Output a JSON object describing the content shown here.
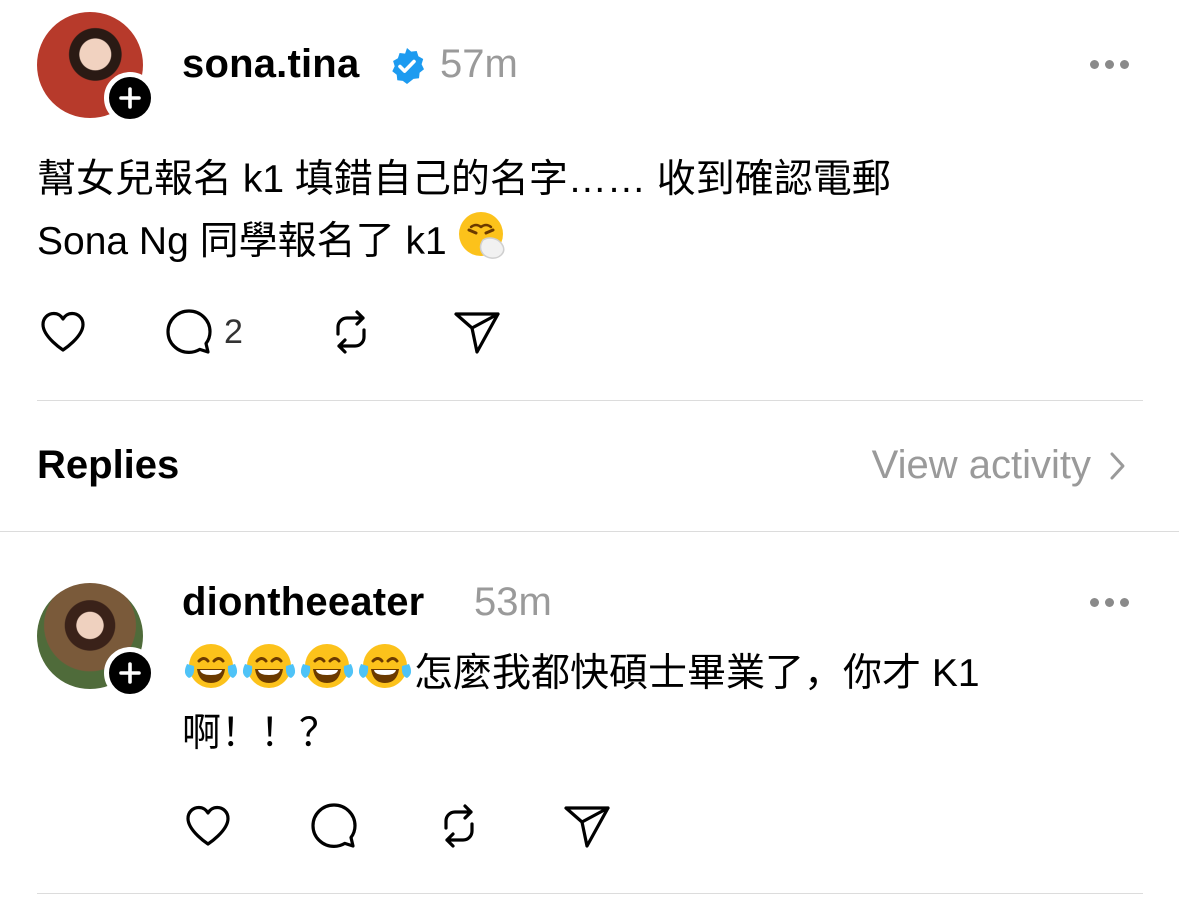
{
  "post": {
    "username": "sona.tina",
    "verified": true,
    "time": "57m",
    "text_line1": "幫女兒報名 k1 填錯自己的名字…… 收到確認電郵",
    "text_line2": "Sona Ng 同學報名了 k1",
    "text_emoji": "sneezing-face",
    "reply_count": "2",
    "actions": [
      "like",
      "comment",
      "repost",
      "share"
    ]
  },
  "replies_header": {
    "label": "Replies",
    "view_activity": "View activity"
  },
  "reply": {
    "username": "diontheeater",
    "time": "53m",
    "emojis": [
      "face-with-tears-of-joy",
      "face-with-tears-of-joy",
      "face-with-tears-of-joy",
      "face-with-tears-of-joy"
    ],
    "text_line1": "怎麼我都快碩士畢業了，你才 K1",
    "text_line2": "啊！！？",
    "actions": [
      "like",
      "comment",
      "repost",
      "share"
    ]
  },
  "colors": {
    "verified_blue": "#1d9bf0",
    "muted_text": "#9a9a9a",
    "divider": "#dcdcdc"
  }
}
